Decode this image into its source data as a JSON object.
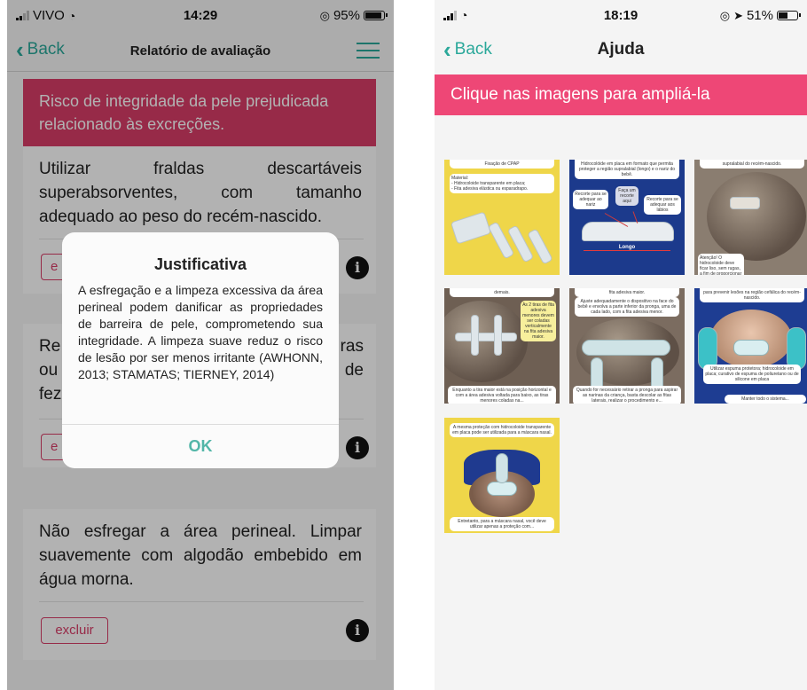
{
  "left_screen": {
    "status": {
      "carrier": "VIVO",
      "time": "14:29",
      "battery": "95%",
      "battery_level": 0.95
    },
    "nav": {
      "back_label": "Back",
      "title": "Relatório de avaliação"
    },
    "diagnosis": "Risco de integridade da pele prejudicada relacionado às excreções.",
    "cards": [
      {
        "text": "Utilizar fraldas descartáveis superabsorventes, com tamanho adequado ao peso do recém-nascido.",
        "delete_label": "e"
      },
      {
        "text_left": "Re\nou\nfez",
        "text_right": "ras\nde",
        "delete_label": "e"
      },
      {
        "text": "Não esfregar a área perineal. Limpar suavemente com algodão embebido em água morna.",
        "delete_label": "excluir"
      }
    ],
    "dialog": {
      "title": "Justificativa",
      "body": "A esfregação e a limpeza excessiva da área perineal podem danificar as propriedades de barreira de pele, comprometendo sua integridade. A limpeza suave reduz o risco de lesão por ser menos irritante (AWHONN, 2013; STAMATAS; TIERNEY, 2014)",
      "ok_label": "OK"
    },
    "info_glyph": "i"
  },
  "right_screen": {
    "status": {
      "time": "18:19",
      "battery": "51%",
      "battery_level": 0.51
    },
    "nav": {
      "back_label": "Back",
      "title": "Ajuda"
    },
    "banner": "Clique nas imagens para ampliá-la",
    "thumbnails": [
      {
        "top": "Fixação de CPAP",
        "caption": "Material:\n- Hidrocoloide transparente em placa;\n- Fita adesiva elástica ou esparadrapo."
      },
      {
        "top": "Hidrocolóide em placa em formato que permita proteger a região supralabial (longo) e o nariz do bebê.",
        "label_a": "Recorte para se adequar ao nariz",
        "label_b": "Faça um recorte aqui",
        "label_c": "Recorte para se adequar aos lábios",
        "label_d": "Longo"
      },
      {
        "top": "supralabial do recém-nascido.",
        "caption": "Atenção! O hidrocoloide deve ficar liso, sem rugas, a fim de proporcionar um..."
      },
      {
        "top": "demais.",
        "caption_side": "As 2 tiras de fita adesiva menores devem ser coladas verticalmente na fita adesiva maior.",
        "caption": "Enquanto a tira maior está na posição horizontal e com a área adesiva voltada para baixo, as tiras menores coladas na..."
      },
      {
        "top": "fita adesiva maior.",
        "caption_top": "Ajuste adequadamente o dispositivo na face do bebê e envolva a parte inferior da pronga, uma de cada lado, com a fita adesiva menor.",
        "caption": "Quando for necessário retirar a pronga para aspirar as narinas da criança, basta descolar as fitas laterais, realizar o procedimento e..."
      },
      {
        "top": "para prevenir lesões na região cefálica do recém-nascido.",
        "caption": "Utilizar espuma protetora; hidrocoloide em placa; curativo de espuma de poliuretano ou de silicone em placa",
        "caption_bottom": "Manter todo o sistema..."
      },
      {
        "top": "A mesma proteção com hidrocoloide transparente em placa pode ser utilizada para a máscara nasal.",
        "caption": "Entretanto, para a máscara nasal, você deve utilizar apenas a proteção com..."
      }
    ]
  }
}
